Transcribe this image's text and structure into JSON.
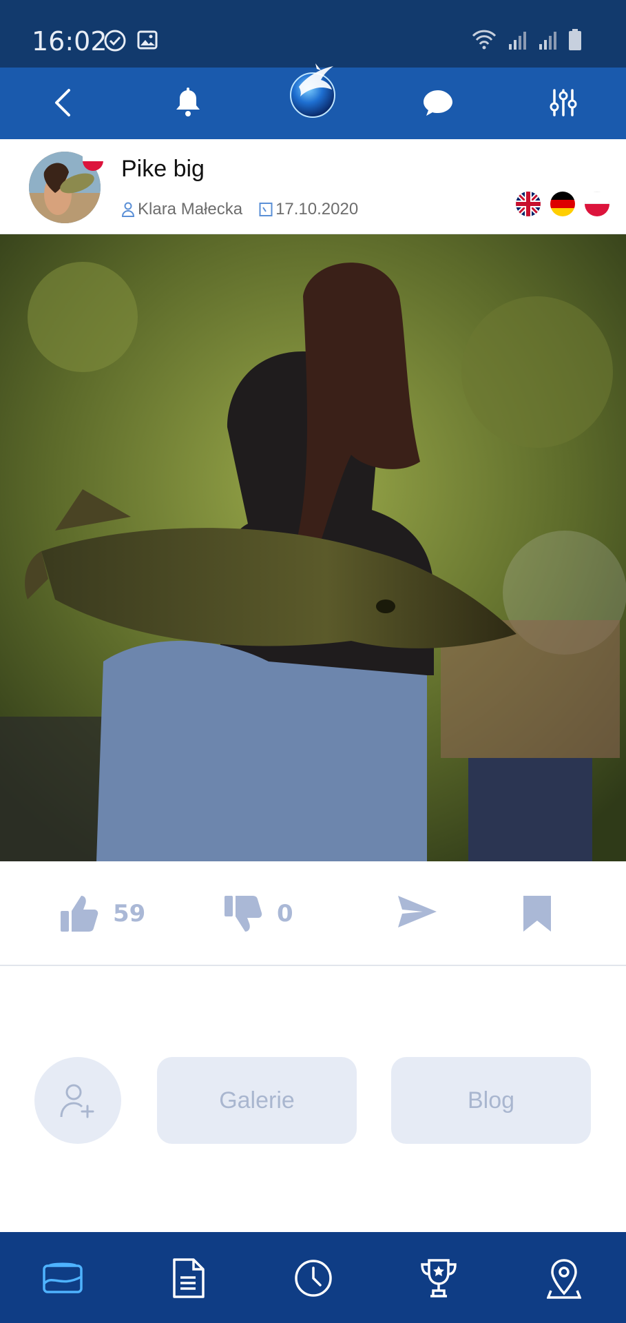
{
  "status_bar": {
    "time": "16:02",
    "icons": [
      "check-circle-icon",
      "image-icon",
      "wifi-icon",
      "signal-icon",
      "signal-icon",
      "battery-icon"
    ]
  },
  "header": {
    "icons": [
      "back-icon",
      "bell-icon",
      "marlin-logo",
      "chat-icon",
      "sliders-icon"
    ]
  },
  "post": {
    "title": "Pike big",
    "author": "Klara Małecka",
    "date": "17.10.2020",
    "languages": [
      "uk-flag",
      "germany-flag",
      "poland-flag"
    ]
  },
  "actions": {
    "likes": "59",
    "dislikes": "0"
  },
  "profile_buttons": {
    "gallery": "Galerie",
    "blog": "Blog"
  },
  "bottom_nav": {
    "items": [
      "gallery-icon",
      "document-icon",
      "clock-icon",
      "trophy-icon",
      "location-icon"
    ],
    "active": "gallery-icon"
  },
  "colors": {
    "status_bar": "#123a6d",
    "header": "#1a5aad",
    "bottom_nav": "#0f3d85",
    "action_icon": "#aab8d6",
    "pill_bg": "#e6ebf5"
  }
}
